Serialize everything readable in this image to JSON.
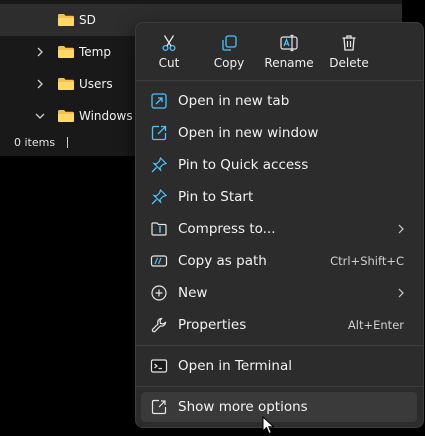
{
  "tree": [
    {
      "label": "SD",
      "selected": true,
      "expander": "none"
    },
    {
      "label": "Temp",
      "expander": "collapsed"
    },
    {
      "label": "Users",
      "expander": "collapsed"
    },
    {
      "label": "Windows",
      "expander": "expanded"
    }
  ],
  "status": {
    "item_count": "0 items"
  },
  "quick_actions": {
    "cut": "Cut",
    "copy": "Copy",
    "rename": "Rename",
    "delete": "Delete"
  },
  "menu": {
    "open_new_tab": "Open in new tab",
    "open_new_window": "Open in new window",
    "pin_quick_access": "Pin to Quick access",
    "pin_start": "Pin to Start",
    "compress": "Compress to...",
    "copy_path": "Copy as path",
    "copy_path_shortcut": "Ctrl+Shift+C",
    "new": "New",
    "properties": "Properties",
    "properties_shortcut": "Alt+Enter",
    "open_terminal": "Open in Terminal",
    "show_more": "Show more options"
  },
  "colors": {
    "accent": "#4cc2ff",
    "folder": "#f3c24d",
    "menu_bg": "#2c2c2c"
  }
}
